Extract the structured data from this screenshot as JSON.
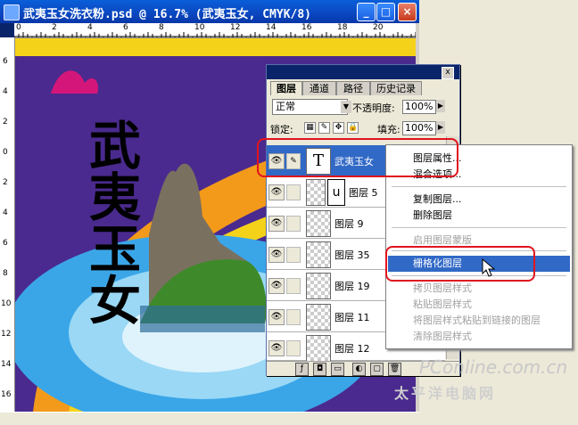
{
  "window": {
    "title": "武夷玉女洗衣粉.psd @ 16.7% (武夷玉女, CMYK/8)",
    "min_label": "_",
    "max_label": "□",
    "close_label": "×"
  },
  "ruler": {
    "h_ticks": [
      "0",
      "2",
      "4",
      "6",
      "8",
      "10",
      "12",
      "14",
      "16",
      "18",
      "20"
    ],
    "v_ticks": [
      "6",
      "4",
      "2",
      "0",
      "2",
      "4",
      "6",
      "8",
      "10",
      "12",
      "14",
      "16"
    ]
  },
  "artwork": {
    "brand_text": "武夷玉女"
  },
  "palette": {
    "close_label": "x",
    "tabs": [
      "图层",
      "通道",
      "路径",
      "历史记录"
    ],
    "blend_mode": "正常",
    "opacity_label": "不透明度:",
    "opacity_value": "100%",
    "lock_label": "锁定:",
    "fill_label": "填充:",
    "fill_value": "100%",
    "layers": [
      {
        "name": "武夷玉女",
        "type": "text",
        "selected": true
      },
      {
        "name": "图层 5",
        "type": "image",
        "selected": false
      },
      {
        "name": "图层 9",
        "type": "image",
        "selected": false
      },
      {
        "name": "图层 35",
        "type": "image",
        "selected": false
      },
      {
        "name": "图层 19",
        "type": "image",
        "selected": false
      },
      {
        "name": "图层 11",
        "type": "image",
        "selected": false
      },
      {
        "name": "图层 12",
        "type": "image",
        "selected": false
      }
    ],
    "text_thumb": "T"
  },
  "context_menu": {
    "items": [
      {
        "label": "图层属性...",
        "enabled": true
      },
      {
        "label": "混合选项...",
        "enabled": true
      },
      {
        "label": "复制图层...",
        "enabled": true
      },
      {
        "label": "删除图层",
        "enabled": true
      },
      {
        "label": "启用图层蒙版",
        "enabled": false
      },
      {
        "label": "栅格化图层",
        "enabled": true,
        "highlighted": true
      },
      {
        "label": "拷贝图层样式",
        "enabled": false
      },
      {
        "label": "粘贴图层样式",
        "enabled": false
      },
      {
        "label": "将图层样式粘贴到链接的图层",
        "enabled": false
      },
      {
        "label": "清除图层样式",
        "enabled": false
      }
    ]
  },
  "watermark": {
    "line1": "PConline.com.cn",
    "line2": "太平洋电脑网"
  },
  "colors": {
    "accent": "#3169c6",
    "highlight_box": "#e0141e",
    "canvas_bg": "#4a2a8e"
  }
}
